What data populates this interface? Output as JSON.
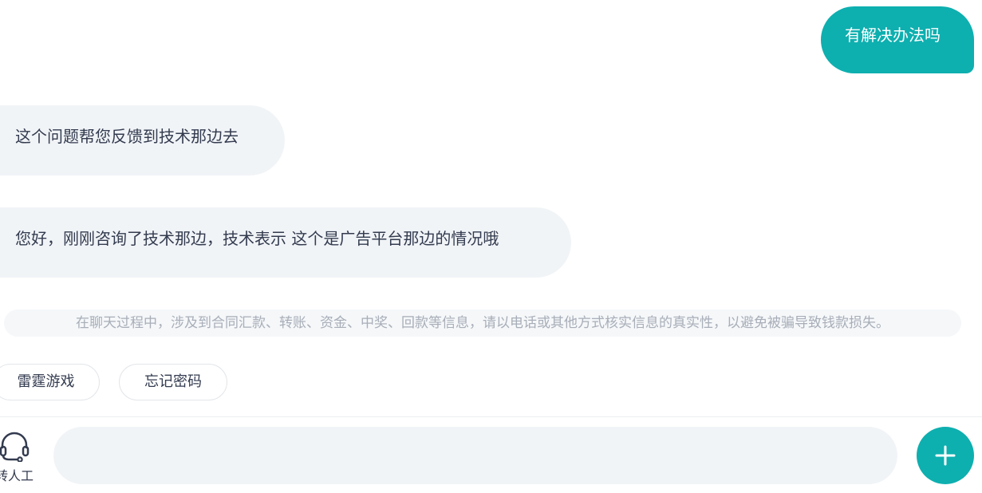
{
  "messages": [
    {
      "role": "user",
      "text": "有解决办法吗"
    },
    {
      "role": "agent",
      "text": "这个问题帮您反馈到技术那边去"
    },
    {
      "role": "agent",
      "text": "您好，刚刚咨询了技术那边，技术表示 这个是广告平台那边的情况哦"
    }
  ],
  "notice": "在聊天过程中，涉及到合同汇款、转账、资金、中奖、回款等信息，请以电话或其他方式核实信息的真实性，以避免被骗导致钱款损失。",
  "quick_replies": [
    "雷霆游戏",
    "忘记密码"
  ],
  "composer": {
    "transfer_label": "转人工",
    "input_value": "",
    "transfer_icon": "headset-icon",
    "more_icon": "plus-icon"
  },
  "colors": {
    "accent": "#0eafaf",
    "bubble_bg": "#f1f4f7",
    "text": "#333b4f",
    "notice_text": "#a8aeb8"
  }
}
